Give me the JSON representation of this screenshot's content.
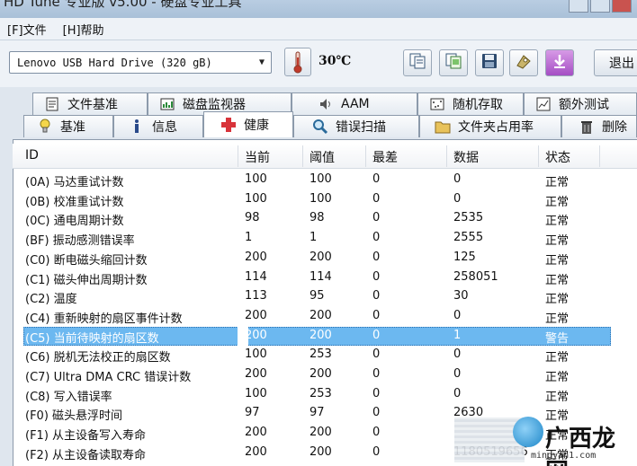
{
  "window": {
    "title": "HD Tune 专业版 v5.00 - 硬盘专业工具"
  },
  "menu": [
    {
      "label": "[F]文件"
    },
    {
      "label": "[H]帮助"
    }
  ],
  "toolbar": {
    "drive": "Lenovo  USB Hard Drive (320 gB)",
    "temperature": "30℃",
    "exit_label": "退出",
    "icons": [
      "copy-text-icon",
      "copy-screen-icon",
      "save-icon",
      "options-icon",
      "download-icon"
    ]
  },
  "tabs_row1": [
    {
      "label": "文件基准",
      "icon": "file-benchmark-icon"
    },
    {
      "label": "磁盘监视器",
      "icon": "disk-monitor-icon"
    },
    {
      "label": "AAM",
      "icon": "speaker-icon"
    },
    {
      "label": "随机存取",
      "icon": "random-access-icon"
    },
    {
      "label": "额外测试",
      "icon": "extra-tests-icon"
    }
  ],
  "tabs_row2": [
    {
      "label": "基准",
      "icon": "benchmark-icon"
    },
    {
      "label": "信息",
      "icon": "info-icon"
    },
    {
      "label": "健康",
      "icon": "health-icon",
      "active": true
    },
    {
      "label": "错误扫描",
      "icon": "error-scan-icon"
    },
    {
      "label": "文件夹占用率",
      "icon": "folder-usage-icon"
    },
    {
      "label": "删除",
      "icon": "erase-icon"
    }
  ],
  "table": {
    "columns": [
      "ID",
      "当前",
      "阈值",
      "最差",
      "数据",
      "状态"
    ],
    "rows": [
      {
        "id": "(0A) 马达重试计数",
        "current": "100",
        "threshold": "100",
        "worst": "0",
        "data": "0",
        "status": "正常"
      },
      {
        "id": "(0B) 校准重试计数",
        "current": "100",
        "threshold": "100",
        "worst": "0",
        "data": "0",
        "status": "正常"
      },
      {
        "id": "(0C) 通电周期计数",
        "current": "98",
        "threshold": "98",
        "worst": "0",
        "data": "2535",
        "status": "正常"
      },
      {
        "id": "(BF) 振动感测错误率",
        "current": "1",
        "threshold": "1",
        "worst": "0",
        "data": "2555",
        "status": "正常"
      },
      {
        "id": "(C0) 断电磁头缩回计数",
        "current": "200",
        "threshold": "200",
        "worst": "0",
        "data": "125",
        "status": "正常"
      },
      {
        "id": "(C1) 磁头伸出周期计数",
        "current": "114",
        "threshold": "114",
        "worst": "0",
        "data": "258051",
        "status": "正常"
      },
      {
        "id": "(C2) 温度",
        "current": "113",
        "threshold": "95",
        "worst": "0",
        "data": "30",
        "status": "正常"
      },
      {
        "id": "(C4) 重新映射的扇区事件计数",
        "current": "200",
        "threshold": "200",
        "worst": "0",
        "data": "0",
        "status": "正常"
      },
      {
        "id": "(C5) 当前待映射的扇区数",
        "current": "200",
        "threshold": "200",
        "worst": "0",
        "data": "1",
        "status": "警告",
        "selected": true
      },
      {
        "id": "(C6) 脱机无法校正的扇区数",
        "current": "100",
        "threshold": "253",
        "worst": "0",
        "data": "0",
        "status": "正常"
      },
      {
        "id": "(C7) Ultra DMA CRC 错误计数",
        "current": "200",
        "threshold": "200",
        "worst": "0",
        "data": "0",
        "status": "正常"
      },
      {
        "id": "(C8) 写入错误率",
        "current": "100",
        "threshold": "253",
        "worst": "0",
        "data": "0",
        "status": "正常"
      },
      {
        "id": "(F0) 磁头悬浮时间",
        "current": "97",
        "threshold": "97",
        "worst": "0",
        "data": "2630",
        "status": "正常"
      },
      {
        "id": "(F1) 从主设备写入寿命",
        "current": "200",
        "threshold": "200",
        "worst": "0",
        "data": "",
        "status": "正常"
      },
      {
        "id": "(F2) 从主设备读取寿命",
        "current": "200",
        "threshold": "200",
        "worst": "0",
        "data": "1180519656",
        "status": "正常"
      }
    ]
  },
  "watermark": {
    "text": "广西龙网",
    "url": "mingyan1.com"
  }
}
